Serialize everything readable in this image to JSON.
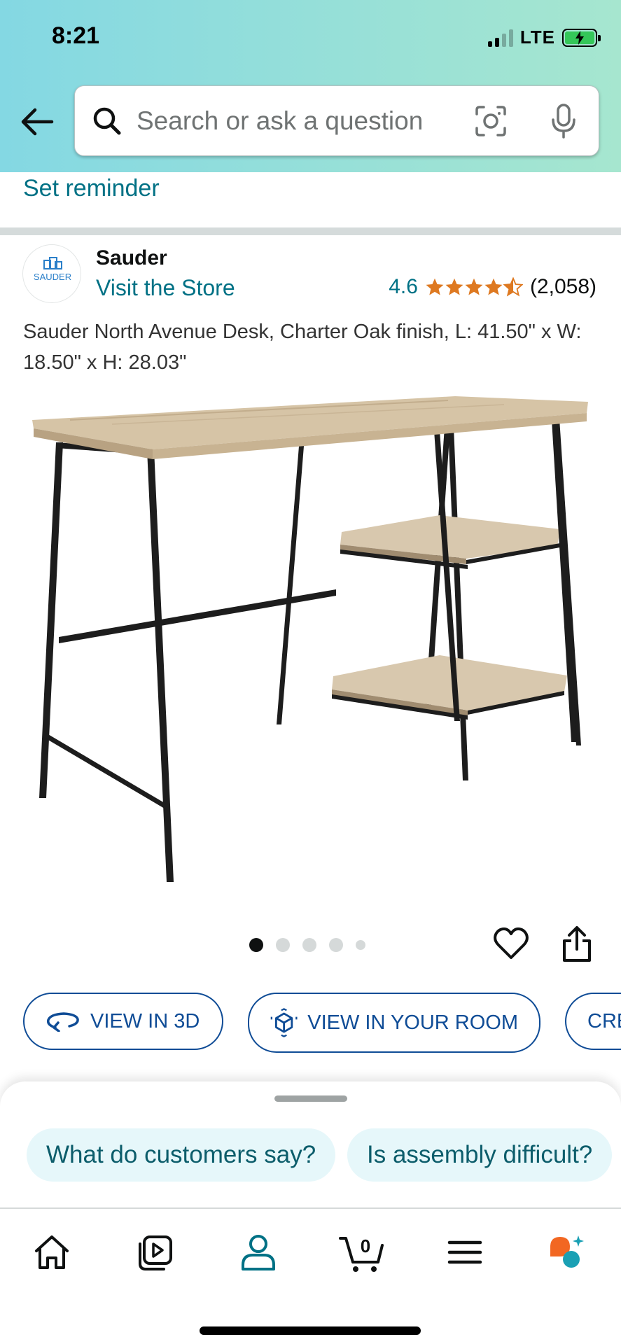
{
  "status_bar": {
    "time": "8:21",
    "network": "LTE"
  },
  "search": {
    "placeholder": "Search or ask a question"
  },
  "reminder_link": "Set reminder",
  "brand": {
    "logo_text": "SAUDER",
    "name": "Sauder",
    "store_link": "Visit the Store"
  },
  "rating": {
    "value": "4.6",
    "stars": 4.5,
    "count": "(2,058)"
  },
  "product": {
    "title": "Sauder North Avenue Desk, Charter Oak finish, L: 41.50\" x W: 18.50\" x H: 28.03\""
  },
  "carousel": {
    "total_images": 5,
    "active_index": 0
  },
  "actions": [
    {
      "label": "VIEW IN 3D",
      "icon": "rotate-3d-icon"
    },
    {
      "label": "VIEW IN YOUR ROOM",
      "icon": "ar-cube-icon"
    },
    {
      "label": "CRE"
    }
  ],
  "suggestions": [
    "What do customers say?",
    "Is assembly difficult?"
  ],
  "bottom_nav": {
    "items": [
      "home-icon",
      "video-icon",
      "account-icon",
      "cart-icon",
      "menu-icon",
      "rufus-icon"
    ],
    "cart_count": "0"
  },
  "colors": {
    "link": "#007185",
    "rating_stars": "#de7921",
    "pill_border": "#0f4c96",
    "chip_bg": "#e6f7fa",
    "active_nav": "#007185"
  }
}
